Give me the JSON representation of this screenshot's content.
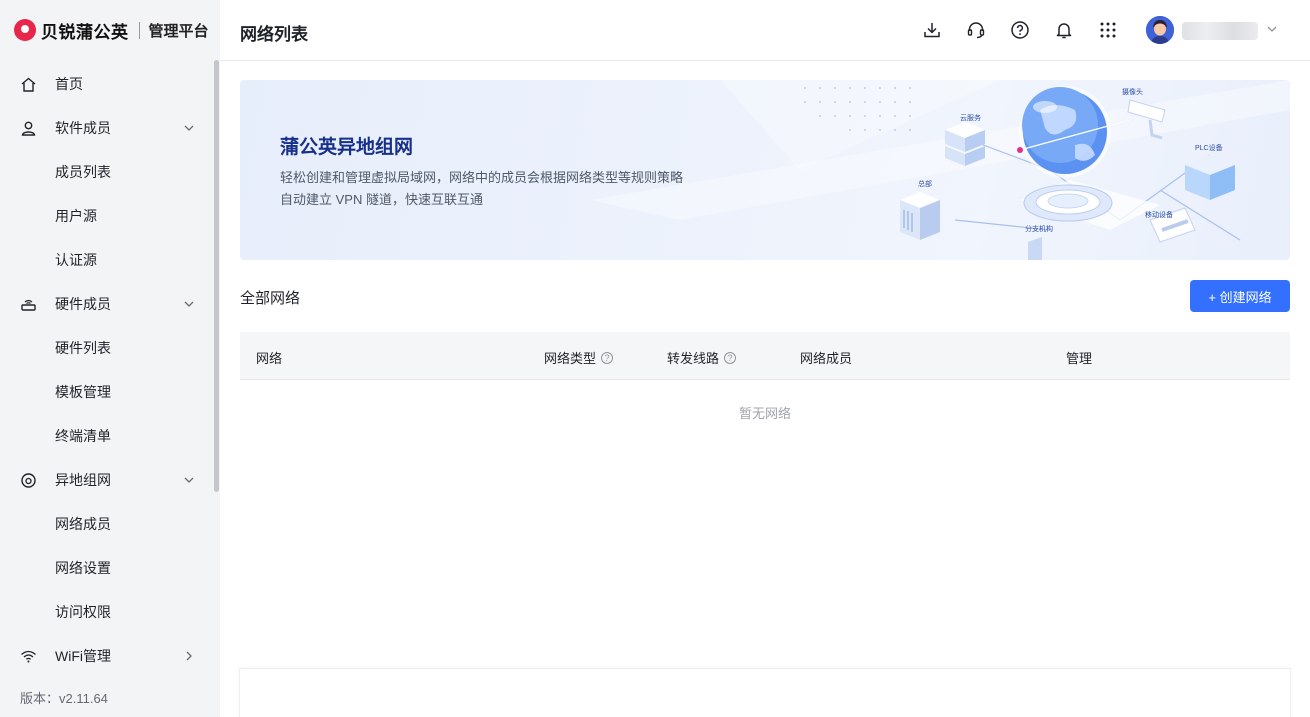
{
  "brand": {
    "name": "贝锐蒲公英",
    "subtitle": "管理平台"
  },
  "sidebar": {
    "items": [
      {
        "label": "首页",
        "icon": "home-icon"
      },
      {
        "label": "软件成员",
        "icon": "person-icon",
        "expanded": true
      },
      {
        "label": "成员列表"
      },
      {
        "label": "用户源"
      },
      {
        "label": "认证源"
      },
      {
        "label": "硬件成员",
        "icon": "router-icon",
        "expanded": true
      },
      {
        "label": "硬件列表"
      },
      {
        "label": "模板管理"
      },
      {
        "label": "终端清单"
      },
      {
        "label": "异地组网",
        "icon": "network-icon",
        "expanded": true
      },
      {
        "label": "网络成员"
      },
      {
        "label": "网络设置"
      },
      {
        "label": "访问权限"
      },
      {
        "label": "WiFi管理",
        "icon": "wifi-icon",
        "expanded": false
      }
    ],
    "version": "版本：v2.11.64"
  },
  "header": {
    "title": "网络列表",
    "icons": [
      "download-icon",
      "headset-icon",
      "help-icon",
      "bell-icon",
      "apps-grid-icon"
    ],
    "user": {
      "avatar": "avatar-icon"
    }
  },
  "banner": {
    "title": "蒲公英异地组网",
    "desc_line1": "轻松创建和管理虚拟局域网，网络中的成员会根据网络类型等规则策略",
    "desc_line2": "自动建立 VPN 隧道，快速互联互通",
    "art_labels": {
      "cloud": "云服务",
      "camera": "摄像头",
      "plc": "PLC设备",
      "hq": "总部",
      "mobile": "移动设备",
      "branch": "分支机构"
    }
  },
  "section": {
    "title": "全部网络",
    "create_button": "+ 创建网络"
  },
  "table": {
    "columns": [
      "网络",
      "网络类型",
      "转发线路",
      "网络成员",
      "管理"
    ],
    "help_mark": "?",
    "empty_text": "暂无网络"
  },
  "colors": {
    "accent": "#3370ff",
    "brand": "#e8264a",
    "sidebar_bg": "#f3f4f6",
    "banner_title": "#17308a"
  }
}
